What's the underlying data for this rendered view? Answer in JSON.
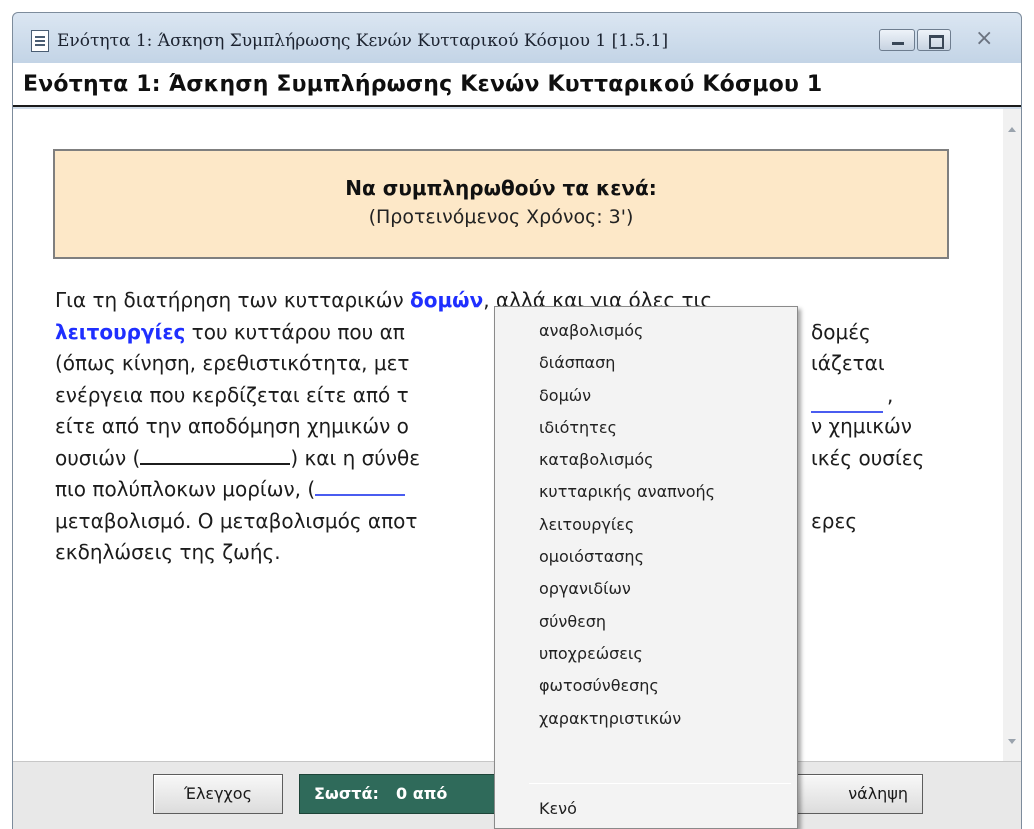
{
  "window": {
    "title": "Ενότητα 1: Άσκηση Συμπλήρωσης Κενών Κυτταρικού Κόσμου 1   [1.5.1]"
  },
  "header": {
    "title": "Ενότητα 1: Άσκηση Συμπλήρωσης Κενών Κυτταρικού Κόσμου 1"
  },
  "instructions": {
    "title": "Να συμπληρωθούν τα κενά:",
    "subtitle": "(Προτεινόμενος Χρόνος: 3')"
  },
  "passage": {
    "line1_a": "Για τη διατήρηση των κυτταρικών ",
    "word1": "δομών",
    "line1_b": ", αλλά και για όλες τις",
    "word2": "λειτουργίες",
    "line2_b": " του κυττάρου που απ",
    "line2_c": "δομές",
    "line3": "(όπως κίνηση, ερεθιστικότητα, μετ",
    "line3_c": "ιάζεται",
    "line4": "ενέργεια που κερδίζεται είτε από τ",
    "line4_c": ",",
    "line5": "είτε από την αποδόμηση χημικών ο",
    "line5_c": "ν χημικών",
    "line6_a": "ουσιών (",
    "line6_b": ") και η σύνθε",
    "line6_c": "ικές ουσίες",
    "line7": "πιο πολύπλοκων μορίων, (",
    "line8": "μεταβολισμό. Ο μεταβολισμός αποτ",
    "line8_c": "ερες",
    "line9": "εκδηλώσεις της ζωής."
  },
  "dropdown": {
    "items": [
      "αναβολισμός",
      "διάσπαση",
      "δομών",
      "ιδιότητες",
      "καταβολισμός",
      "κυτταρικής αναπνοής",
      "λειτουργίες",
      "ομοιόστασης",
      "οργανιδίων",
      "σύνθεση",
      "υποχρεώσεις",
      "φωτοσύνθεσης",
      "χαρακτηριστικών"
    ],
    "empty_option": "Κενό"
  },
  "bottom": {
    "check_label": "Έλεγχος",
    "score_label": "Σωστά:",
    "score_value": "0 από",
    "reset_label": "νάληψη"
  },
  "colors": {
    "accent_word": "#1f2fff",
    "instructions_bg": "#fde8c8",
    "score_bg": "#2f6a5a"
  }
}
